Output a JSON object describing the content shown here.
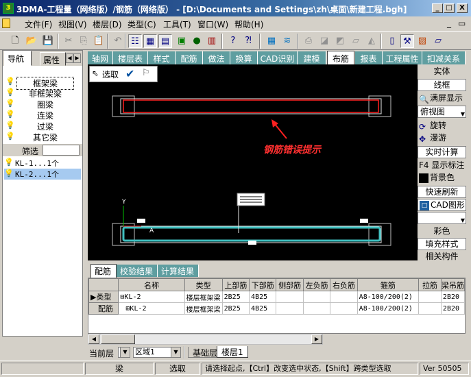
{
  "window": {
    "title": "3DMA-工程量（网络版）/钢筋（网络版） - [D:\\Documents and Settings\\zh\\桌面\\新建工程.bgh]",
    "minimize": "_",
    "maximize": "□",
    "close": "X"
  },
  "menu": [
    {
      "label": "文件(F)"
    },
    {
      "label": "视图(V)"
    },
    {
      "label": "楼层(D)"
    },
    {
      "label": "类型(C)"
    },
    {
      "label": "工具(T)"
    },
    {
      "label": "窗口(W)"
    },
    {
      "label": "帮助(H)"
    }
  ],
  "menu_right": {
    "restore": "_",
    "restore2": "▭"
  },
  "sidebar": {
    "tabs": [
      {
        "label": "导航"
      },
      {
        "label": "属性"
      }
    ],
    "categories": [
      {
        "label": "框架梁"
      },
      {
        "label": "非框架梁"
      },
      {
        "label": "圈梁"
      },
      {
        "label": "连梁"
      },
      {
        "label": "过梁"
      },
      {
        "label": "其它梁"
      }
    ],
    "filter_label": "筛选",
    "members": [
      {
        "label": "KL-1...1个"
      },
      {
        "label": "KL-2...1个"
      }
    ]
  },
  "main_tabs": [
    {
      "label": "轴网"
    },
    {
      "label": "楼层表"
    },
    {
      "label": "样式"
    },
    {
      "label": "配筋"
    },
    {
      "label": "做法"
    },
    {
      "label": "换算"
    },
    {
      "label": "CAD识别"
    },
    {
      "label": "建模"
    },
    {
      "label": "布筋"
    },
    {
      "label": "报表"
    },
    {
      "label": "工程属性"
    },
    {
      "label": "扣减关系"
    }
  ],
  "canvas": {
    "select_label": "选取",
    "error_hint": "钢筋错误提示",
    "axis_y": "Y",
    "axis_a": "A"
  },
  "right_panel": [
    {
      "label": "实体"
    },
    {
      "label": "线框"
    },
    {
      "label": "满屏显示"
    },
    {
      "label": "俯视图"
    },
    {
      "label": "旋转"
    },
    {
      "label": "漫游"
    },
    {
      "label": "实时计算"
    },
    {
      "label": "F4 显示标注"
    },
    {
      "label": "背景色"
    },
    {
      "label": "快速刷新"
    },
    {
      "label": "CAD图形"
    },
    {
      "label": ""
    },
    {
      "label": "彩色"
    },
    {
      "label": "填充样式"
    },
    {
      "label": "相关构件"
    }
  ],
  "bottom_tabs": [
    {
      "label": "配筋"
    },
    {
      "label": "校验结果"
    },
    {
      "label": "计算结果"
    }
  ],
  "grid": {
    "columns": [
      "名称",
      "类型",
      "上部筋",
      "下部筋",
      "侧部筋",
      "左负筋",
      "右负筋",
      "箍筋",
      "拉筋",
      "梁吊筋"
    ],
    "rows": [
      {
        "header": "类型",
        "cells": [
          "⊟KL-2",
          "楼层框架梁",
          "2B25",
          "4B25",
          "",
          "",
          "",
          "A8-100/200(2)",
          "",
          "2B20"
        ]
      },
      {
        "header": "配筋",
        "cells": [
          "⊞KL-2",
          "楼层框架梁",
          "2B25",
          "4B25",
          "",
          "",
          "",
          "A8-100/200(2)",
          "",
          "2B20"
        ]
      }
    ]
  },
  "layerbar": {
    "label": "当前层",
    "area_value": "区域1",
    "sheet_tabs": [
      {
        "label": "基础层"
      },
      {
        "label": "楼层1"
      }
    ]
  },
  "status": {
    "member": "梁",
    "mode": "选取",
    "message": "请选择起点,【Ctrl】改变选中状态,【Shift】跨类型选取",
    "version": "Ver 50505"
  },
  "colors": {
    "title_bar": "#0a246a",
    "tab_bg": "#5f9ea0",
    "error_text": "#ff3030",
    "beam_outline": "#40c0c0"
  }
}
